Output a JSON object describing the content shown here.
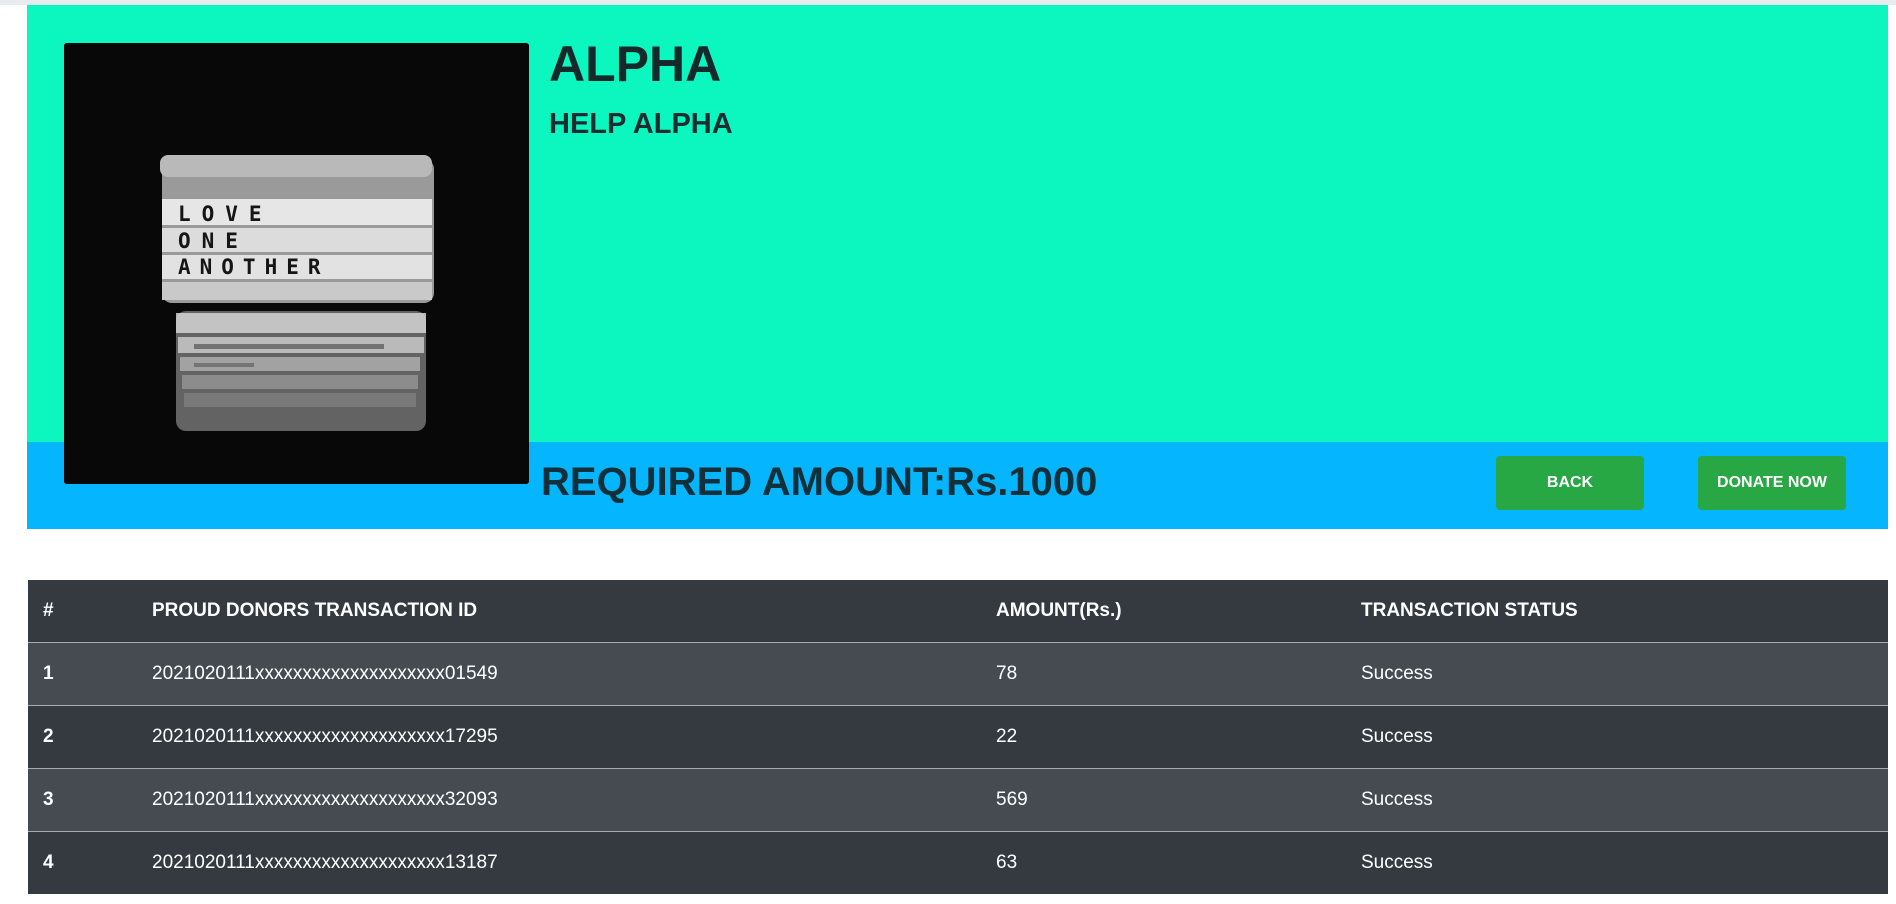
{
  "campaign": {
    "title": "ALPHA",
    "subtitle": "HELP ALPHA",
    "required_amount": "REQUIRED AMOUNT:Rs.1000",
    "image_sign_lines": [
      "LOVE",
      "ONE",
      "ANOTHER"
    ]
  },
  "buttons": {
    "back_label": "BACK",
    "donate_label": "DONATE NOW"
  },
  "donors_table": {
    "headers": [
      "#",
      "PROUD DONORS TRANSACTION ID",
      "AMOUNT(Rs.)",
      "TRANSACTION STATUS"
    ],
    "rows": [
      {
        "num": "1",
        "txn_id": "2021020111xxxxxxxxxxxxxxxxxxxx01549",
        "amount": "78",
        "status": "Success"
      },
      {
        "num": "2",
        "txn_id": "2021020111xxxxxxxxxxxxxxxxxxxx17295",
        "amount": "22",
        "status": "Success"
      },
      {
        "num": "3",
        "txn_id": "2021020111xxxxxxxxxxxxxxxxxxxx32093",
        "amount": "569",
        "status": "Success"
      },
      {
        "num": "4",
        "txn_id": "2021020111xxxxxxxxxxxxxxxxxxxx13187",
        "amount": "63",
        "status": "Success"
      }
    ]
  },
  "colors": {
    "hero_bg": "#0cf6c0",
    "hero_bar_bg": "#05b5fd",
    "button_bg": "#28a745",
    "table_bg": "#343a40",
    "table_row_alt": "#454b51"
  }
}
